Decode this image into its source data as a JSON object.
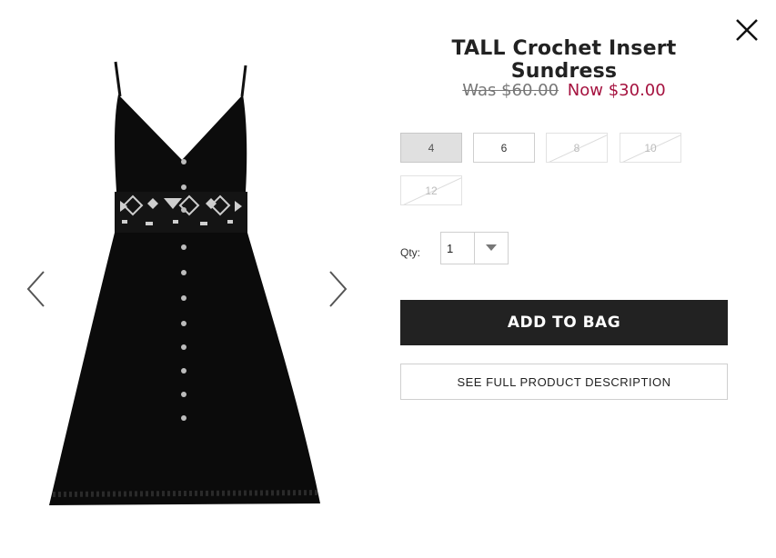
{
  "modal": {
    "close_icon": "close-icon",
    "prev_icon": "chevron-left-icon",
    "next_icon": "chevron-right-icon"
  },
  "product": {
    "title": "TALL Crochet Insert Sundress",
    "was_price": "Was $60.00",
    "now_price": "Now $30.00",
    "sale_color": "#a5123f"
  },
  "sizes": [
    {
      "label": "4",
      "state": "selected"
    },
    {
      "label": "6",
      "state": "available"
    },
    {
      "label": "8",
      "state": "unavailable"
    },
    {
      "label": "10",
      "state": "unavailable"
    },
    {
      "label": "12",
      "state": "unavailable"
    }
  ],
  "quantity": {
    "label": "Qty:",
    "value": "1"
  },
  "actions": {
    "add_to_bag": "ADD TO BAG",
    "see_description": "SEE FULL PRODUCT DESCRIPTION"
  }
}
